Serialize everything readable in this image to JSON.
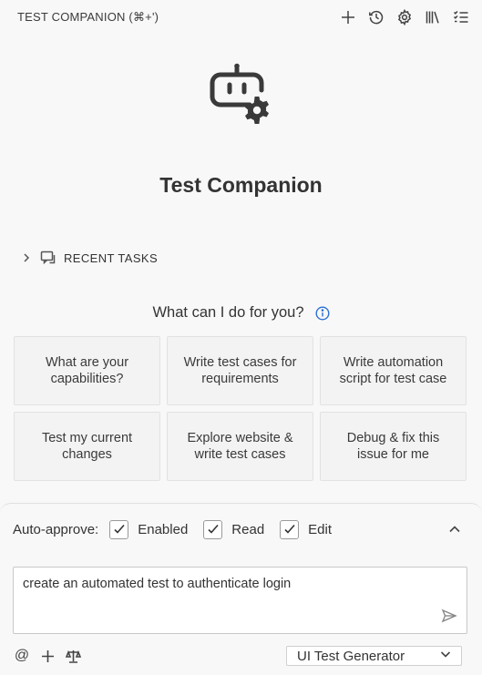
{
  "header": {
    "title": "TEST COMPANION (⌘+')",
    "actions": [
      "plus-icon",
      "history-icon",
      "gear-icon",
      "library-icon",
      "checklist-icon"
    ]
  },
  "app": {
    "title": "Test Companion",
    "logo_icon": "robot-gear-icon"
  },
  "recent_tasks": {
    "label": "RECENT TASKS"
  },
  "prompt": {
    "question": "What can I do for you?"
  },
  "suggestions": [
    "What are your capabilities?",
    "Write test cases for requirements",
    "Write automation script for test case",
    "Test my current changes",
    "Explore website & write test cases",
    "Debug & fix this issue for me"
  ],
  "auto_approve": {
    "label": "Auto-approve:",
    "options": [
      {
        "label": "Enabled",
        "checked": true
      },
      {
        "label": "Read",
        "checked": true
      },
      {
        "label": "Edit",
        "checked": true
      }
    ]
  },
  "input": {
    "value": "create an automated test to authenticate login"
  },
  "footer": {
    "at_symbol": "@",
    "mode_selected": "UI Test Generator"
  }
}
